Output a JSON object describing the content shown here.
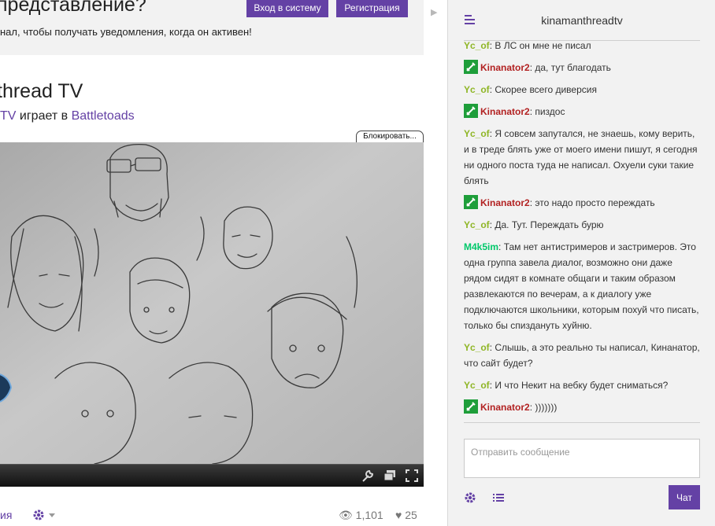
{
  "promo": {
    "title": "представление?",
    "subtitle": "нал, чтобы получать уведомления, когда он активен!",
    "login_label": "Вход в систему",
    "signup_label": "Регистрация"
  },
  "channel": {
    "title": "thread TV",
    "owner_fragment": "TV",
    "playing_text": " играет в ",
    "game": "Battletoads",
    "block_label": "Блокировать..."
  },
  "video_controls": {
    "icons": [
      "wrench-icon",
      "popout-icon",
      "fullscreen-icon"
    ]
  },
  "footer": {
    "left_link": "ия",
    "views": "1,101",
    "likes": "25"
  },
  "chat": {
    "title": "kinamanthreadtv",
    "input_placeholder": "Отправить сообщение",
    "send_label": "Чат",
    "nick_colors": {
      "Yc_of": "#8fb626",
      "Kinanator2": "#b22222",
      "M4k5im": "#00c86a"
    },
    "messages": [
      {
        "nick": "Yc_of",
        "text": "В ЛС он мне не писал",
        "badge": false
      },
      {
        "nick": "Kinanator2",
        "text": "да, тут благодать",
        "badge": true
      },
      {
        "nick": "Yc_of",
        "text": "Скорее всего диверсия",
        "badge": false
      },
      {
        "nick": "Kinanator2",
        "text": "пиздос",
        "badge": true
      },
      {
        "nick": "Yc_of",
        "text": "Я совсем запутался, не знаешь, кому верить, и в треде блять уже от моего имени пишут, я сегодня ни одного поста туда не написал. Охуели суки такие блять",
        "badge": false
      },
      {
        "nick": "Kinanator2",
        "text": "это надо просто переждать",
        "badge": true
      },
      {
        "nick": "Yc_of",
        "text": "Да. Тут. Переждать бурю",
        "badge": false
      },
      {
        "nick": "M4k5im",
        "text": "Там нет антистримеров и застримеров. Это одна группа завела диалог, возможно они даже рядом сидят в комнате общаги и таким образом развлекаются по вечерам, а к диалогу уже подключаются школьники, которым похуй что писать, только бы спиздануть хуйню.",
        "badge": false
      },
      {
        "nick": "Yc_of",
        "text": "Слышь, а это реально ты написал, Кинанатор, что сайт будет?",
        "badge": false
      },
      {
        "nick": "Yc_of",
        "text": "И что Некит на вебку будет сниматься?",
        "badge": false
      },
      {
        "nick": "Kinanator2",
        "text": ")))))))",
        "badge": true
      }
    ]
  }
}
